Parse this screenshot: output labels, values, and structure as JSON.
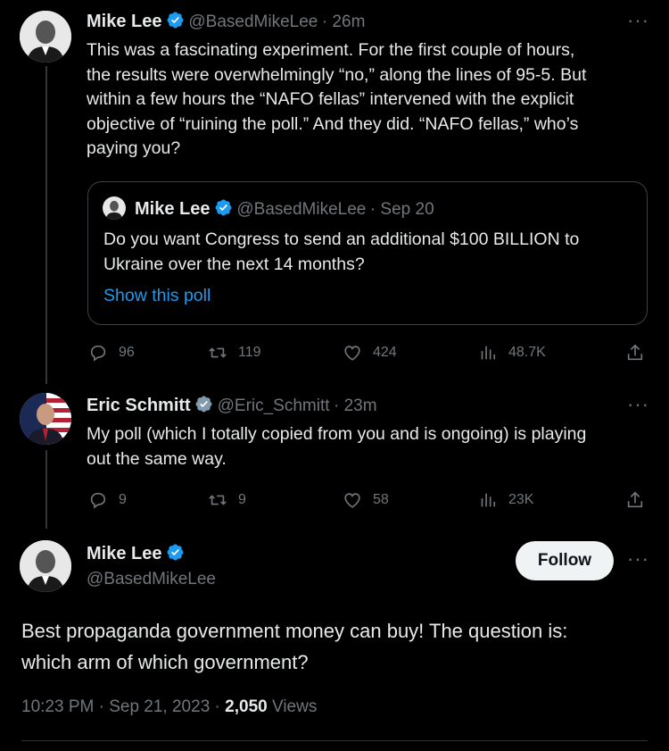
{
  "tweet1": {
    "name": "Mike Lee",
    "handle": "@BasedMikeLee",
    "time": "· 26m",
    "text_lines": [
      "This was a fascinating experiment. For the first couple of hours,",
      "the results were overwhelmingly “no,” along the lines of 95-5. But",
      "within a few hours the “NAFO fellas” intervened with the explicit",
      "objective of “ruining the poll.” And they did. “NAFO fellas,” who’s",
      "paying you?"
    ],
    "quote": {
      "name": "Mike Lee",
      "handle": "@BasedMikeLee",
      "time": "· Sep 20",
      "text_lines": [
        "Do you want Congress to send an additional $100 BILLION to",
        "Ukraine over the next 14 months?"
      ],
      "link": "Show this poll"
    },
    "replies": "96",
    "retweets": "119",
    "likes": "424",
    "views": "48.7K"
  },
  "tweet2": {
    "name": "Eric Schmitt",
    "handle": "@Eric_Schmitt",
    "time": "· 23m",
    "text_lines": [
      "My poll (which I totally copied from you and is ongoing) is playing",
      "out the same way."
    ],
    "replies": "9",
    "retweets": "9",
    "likes": "58",
    "views": "23K"
  },
  "main": {
    "name": "Mike Lee",
    "handle": "@BasedMikeLee",
    "follow_label": "Follow",
    "text_lines": [
      "Best propaganda government money can buy! The question is:",
      "which arm of which government?"
    ],
    "time": "10:23 PM · Sep 21, 2023 ·",
    "views_count": "2,050",
    "views_label": "Views"
  },
  "colors": {
    "background": "#000000",
    "text": "#e7e9ea",
    "muted": "#71767b",
    "link": "#1d9bf0",
    "verified": "#1d9bf0"
  },
  "icons": [
    "reply-icon",
    "retweet-icon",
    "like-icon",
    "views-icon",
    "share-icon",
    "more-icon",
    "verified-icon"
  ]
}
